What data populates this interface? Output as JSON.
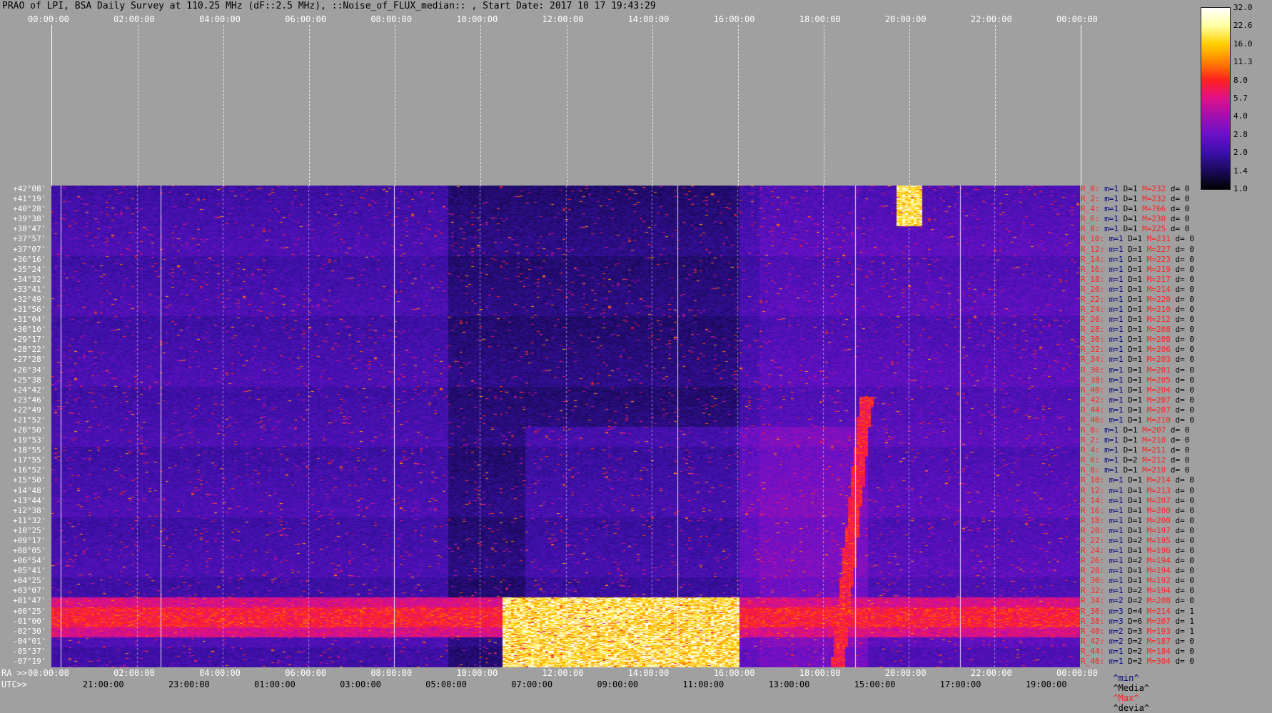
{
  "title": "PRAO of LPI, BSA Daily Survey at 110.25 MHz (dF::2.5 MHz), ::Noise_of_FLUX_median:: , Start Date: 2017 10 17 19:43:29",
  "top_axis_ticks": [
    "00:00:00",
    "02:00:00",
    "04:00:00",
    "06:00:00",
    "08:00:00",
    "10:00:00",
    "12:00:00",
    "14:00:00",
    "16:00:00",
    "18:00:00",
    "20:00:00",
    "22:00:00",
    "00:00:00"
  ],
  "ra_axis": {
    "prefix": "RA >>",
    "ticks": [
      "00:00:00",
      "02:00:00",
      "04:00:00",
      "06:00:00",
      "08:00:00",
      "10:00:00",
      "12:00:00",
      "14:00:00",
      "16:00:00",
      "18:00:00",
      "20:00:00",
      "22:00:00",
      "00:00:00"
    ]
  },
  "utc_axis": {
    "prefix": "UTC>>",
    "ticks": [
      "21:00:00",
      "23:00:00",
      "01:00:00",
      "03:00:00",
      "05:00:00",
      "07:00:00",
      "09:00:00",
      "11:00:00",
      "13:00:00",
      "15:00:00",
      "17:00:00",
      "19:00:00"
    ]
  },
  "colorbar": {
    "labels": [
      "32.0",
      "22.6",
      "16.0",
      "11.3",
      "8.0",
      "5.7",
      "4.0",
      "2.8",
      "2.0",
      "1.4",
      "1.0"
    ],
    "colors": [
      "#000000",
      "#1a0a5a",
      "#3a10a8",
      "#6a10c8",
      "#a010b0",
      "#e0108a",
      "#ff2020",
      "#ff8000",
      "#ffd000",
      "#ffffa0",
      "#ffffff"
    ]
  },
  "legend": {
    "min": "^min^",
    "media": "^Media^",
    "max": "^Max^",
    "devia": "^devia^",
    "min_color": "#000080",
    "media_color": "#000000",
    "max_color": "#ff2020",
    "devia_color": "#000000"
  },
  "chart_data": {
    "type": "heatmap",
    "title": "PRAO of LPI, BSA Daily Survey at 110.25 MHz (dF::2.5 MHz), ::Noise_of_FLUX_median:: , Start Date: 2017 10 17 19:43:29",
    "xlabel": "RA",
    "ylabel": "",
    "x_range_hours": [
      0,
      24
    ],
    "declinations": [
      "+42°08'",
      "+41°19'",
      "+40°28'",
      "+39°38'",
      "+38°47'",
      "+37°57'",
      "+37°07'",
      "+36°16'",
      "+35°24'",
      "+34°32'",
      "+33°41'",
      "+32°49'",
      "+31°56'",
      "+31°04'",
      "+30°10'",
      "+29°17'",
      "+28°22'",
      "+27°28'",
      "+26°34'",
      "+25°38'",
      "+24°42'",
      "+23°46'",
      "+22°49'",
      "+21°52'",
      "+20°50'",
      "+19°53'",
      "+18°55'",
      "+17°55'",
      "+16°52'",
      "+15°50'",
      "+14°48'",
      "+13°44'",
      "+12°38'",
      "+11°32'",
      "+10°25'",
      "+09°17'",
      "+08°05'",
      "+06°54'",
      "+05°41'",
      "+04°25'",
      "+03°07'",
      "+01°47'",
      "+00°25'",
      "-01°00'",
      "-02°30'",
      "-04°01'",
      "-05°37'",
      "-07°19'"
    ],
    "row_stats": [
      {
        "r": "R_0:",
        "m": "m=1",
        "d": "D=1",
        "M": "M=232",
        "dev": "d= 0"
      },
      {
        "r": "R_2:",
        "m": "m=1",
        "d": "D=1",
        "M": "M=232",
        "dev": "d= 0"
      },
      {
        "r": "R_4:",
        "m": "m=1",
        "d": "D=1",
        "M": "M=766",
        "dev": "d= 0"
      },
      {
        "r": "R_6:",
        "m": "m=1",
        "d": "D=1",
        "M": "M=230",
        "dev": "d= 0"
      },
      {
        "r": "R_8:",
        "m": "m=1",
        "d": "D=1",
        "M": "M=225",
        "dev": "d= 0"
      },
      {
        "r": "R_10:",
        "m": "m=1",
        "d": "D=1",
        "M": "M=231",
        "dev": "d= 0"
      },
      {
        "r": "R_12:",
        "m": "m=1",
        "d": "D=1",
        "M": "M=227",
        "dev": "d= 0"
      },
      {
        "r": "R_14:",
        "m": "m=1",
        "d": "D=1",
        "M": "M=223",
        "dev": "d= 0"
      },
      {
        "r": "R_16:",
        "m": "m=1",
        "d": "D=1",
        "M": "M=219",
        "dev": "d= 0"
      },
      {
        "r": "R_18:",
        "m": "m=1",
        "d": "D=1",
        "M": "M=217",
        "dev": "d= 0"
      },
      {
        "r": "R_20:",
        "m": "m=1",
        "d": "D=1",
        "M": "M=214",
        "dev": "d= 0"
      },
      {
        "r": "R_22:",
        "m": "m=1",
        "d": "D=1",
        "M": "M=220",
        "dev": "d= 0"
      },
      {
        "r": "R_24:",
        "m": "m=1",
        "d": "D=1",
        "M": "M=210",
        "dev": "d= 0"
      },
      {
        "r": "R_26:",
        "m": "m=1",
        "d": "D=1",
        "M": "M=212",
        "dev": "d= 0"
      },
      {
        "r": "R_28:",
        "m": "m=1",
        "d": "D=1",
        "M": "M=208",
        "dev": "d= 0"
      },
      {
        "r": "R_30:",
        "m": "m=1",
        "d": "D=1",
        "M": "M=208",
        "dev": "d= 0"
      },
      {
        "r": "R_32:",
        "m": "m=1",
        "d": "D=1",
        "M": "M=206",
        "dev": "d= 0"
      },
      {
        "r": "R_34:",
        "m": "m=1",
        "d": "D=1",
        "M": "M=203",
        "dev": "d= 0"
      },
      {
        "r": "R_36:",
        "m": "m=1",
        "d": "D=1",
        "M": "M=201",
        "dev": "d= 0"
      },
      {
        "r": "R_38:",
        "m": "m=1",
        "d": "D=1",
        "M": "M=205",
        "dev": "d= 0"
      },
      {
        "r": "R_40:",
        "m": "m=1",
        "d": "D=1",
        "M": "M=204",
        "dev": "d= 0"
      },
      {
        "r": "R_42:",
        "m": "m=1",
        "d": "D=1",
        "M": "M=207",
        "dev": "d= 0"
      },
      {
        "r": "R_44:",
        "m": "m=1",
        "d": "D=1",
        "M": "M=207",
        "dev": "d= 0"
      },
      {
        "r": "R_46:",
        "m": "m=1",
        "d": "D=1",
        "M": "M=210",
        "dev": "d= 0"
      },
      {
        "r": "R_0:",
        "m": "m=1",
        "d": "D=1",
        "M": "M=207",
        "dev": "d= 0"
      },
      {
        "r": "R_2:",
        "m": "m=1",
        "d": "D=1",
        "M": "M=210",
        "dev": "d= 0"
      },
      {
        "r": "R_4:",
        "m": "m=1",
        "d": "D=1",
        "M": "M=211",
        "dev": "d= 0"
      },
      {
        "r": "R_6:",
        "m": "m=1",
        "d": "D=2",
        "M": "M=212",
        "dev": "d= 0"
      },
      {
        "r": "R_8:",
        "m": "m=1",
        "d": "D=1",
        "M": "M=210",
        "dev": "d= 0"
      },
      {
        "r": "R_10:",
        "m": "m=1",
        "d": "D=1",
        "M": "M=214",
        "dev": "d= 0"
      },
      {
        "r": "R_12:",
        "m": "m=1",
        "d": "D=1",
        "M": "M=213",
        "dev": "d= 0"
      },
      {
        "r": "R_14:",
        "m": "m=1",
        "d": "D=1",
        "M": "M=207",
        "dev": "d= 0"
      },
      {
        "r": "R_16:",
        "m": "m=1",
        "d": "D=1",
        "M": "M=200",
        "dev": "d= 0"
      },
      {
        "r": "R_18:",
        "m": "m=1",
        "d": "D=1",
        "M": "M=200",
        "dev": "d= 0"
      },
      {
        "r": "R_20:",
        "m": "m=1",
        "d": "D=1",
        "M": "M=197",
        "dev": "d= 0"
      },
      {
        "r": "R_22:",
        "m": "m=1",
        "d": "D=2",
        "M": "M=195",
        "dev": "d= 0"
      },
      {
        "r": "R_24:",
        "m": "m=1",
        "d": "D=1",
        "M": "M=196",
        "dev": "d= 0"
      },
      {
        "r": "R_26:",
        "m": "m=1",
        "d": "D=2",
        "M": "M=194",
        "dev": "d= 0"
      },
      {
        "r": "R_28:",
        "m": "m=1",
        "d": "D=1",
        "M": "M=194",
        "dev": "d= 0"
      },
      {
        "r": "R_30:",
        "m": "m=1",
        "d": "D=1",
        "M": "M=192",
        "dev": "d= 0"
      },
      {
        "r": "R_32:",
        "m": "m=1",
        "d": "D=2",
        "M": "M=194",
        "dev": "d= 0"
      },
      {
        "r": "R_34:",
        "m": "m=2",
        "d": "D=2",
        "M": "M=208",
        "dev": "d= 0"
      },
      {
        "r": "R_36:",
        "m": "m=3",
        "d": "D=4",
        "M": "M=214",
        "dev": "d= 1"
      },
      {
        "r": "R_38:",
        "m": "m=3",
        "d": "D=6",
        "M": "M=207",
        "dev": "d= 1"
      },
      {
        "r": "R_40:",
        "m": "m=2",
        "d": "D=3",
        "M": "M=193",
        "dev": "d= 1"
      },
      {
        "r": "R_42:",
        "m": "m=2",
        "d": "D=2",
        "M": "M=187",
        "dev": "d= 0"
      },
      {
        "r": "R_44:",
        "m": "m=1",
        "d": "D=2",
        "M": "M=184",
        "dev": "d= 0"
      },
      {
        "r": "R_46:",
        "m": "m=1",
        "d": "D=2",
        "M": "M=304",
        "dev": "d= 0"
      }
    ],
    "color_scale": {
      "min": 1.0,
      "max": 32.0,
      "scale": "log2"
    }
  }
}
